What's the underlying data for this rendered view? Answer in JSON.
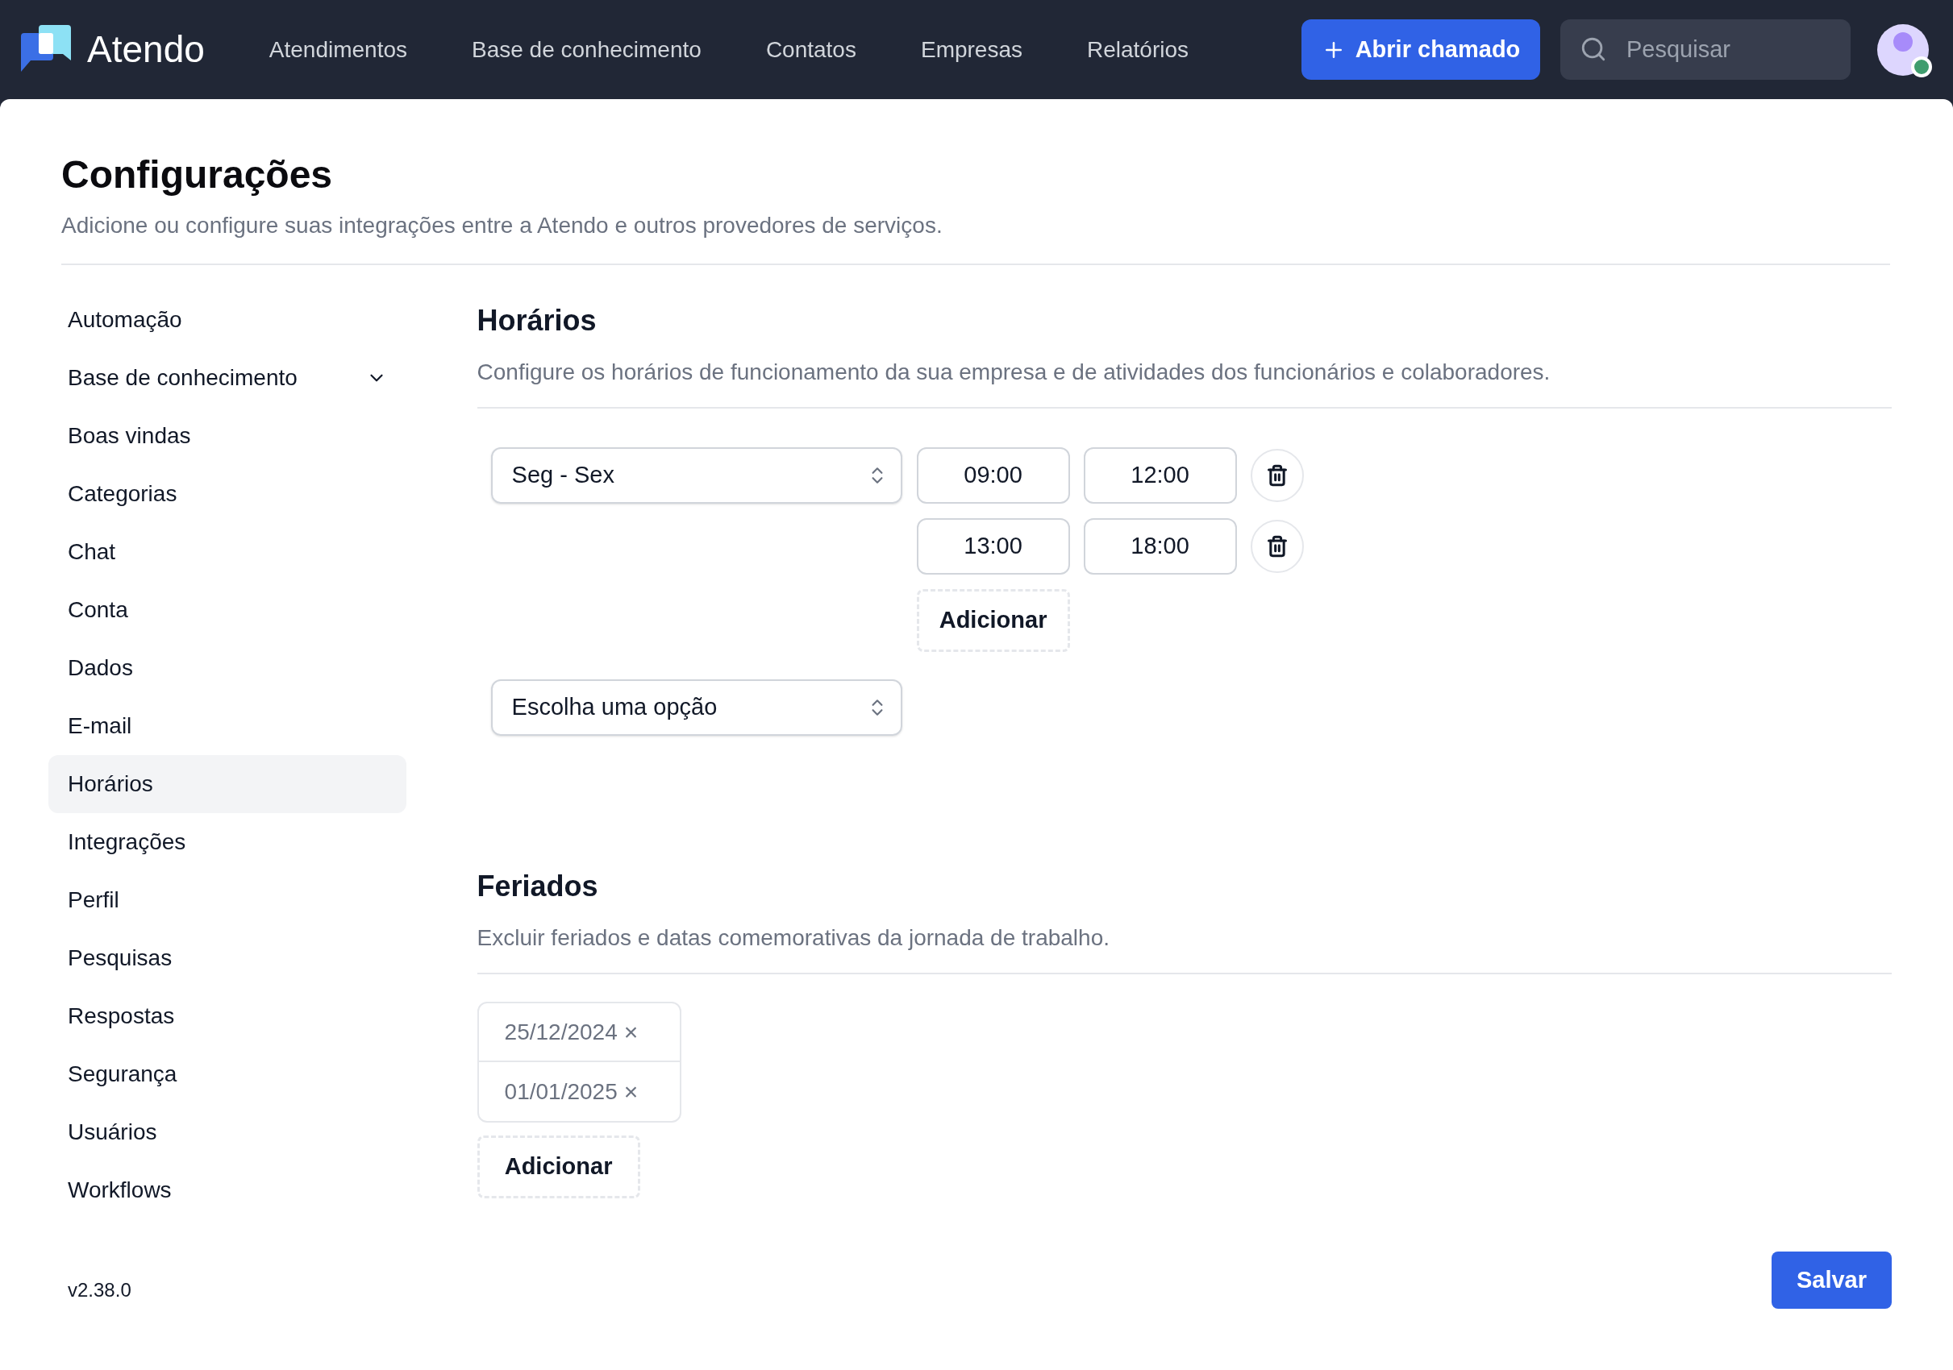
{
  "header": {
    "brand": "Atendo",
    "nav": [
      {
        "label": "Atendimentos",
        "selected": false
      },
      {
        "label": "Base de conhecimento",
        "selected": false
      },
      {
        "label": "Contatos",
        "selected": false
      },
      {
        "label": "Empresas",
        "selected": false
      },
      {
        "label": "Relatórios",
        "selected": false
      }
    ],
    "new_button": "Abrir chamado",
    "search": {
      "placeholder": "Pesquisar"
    },
    "avatar": {
      "online": true
    }
  },
  "page": {
    "title": "Configurações",
    "subtitle": "Adicione ou configure suas integrações entre a Atendo e outros provedores de serviços."
  },
  "sidebar": {
    "items": [
      {
        "label": "Automação",
        "selected": false,
        "expandable": false
      },
      {
        "label": "Base de conhecimento",
        "selected": false,
        "expandable": true
      },
      {
        "label": "Boas vindas",
        "selected": false,
        "expandable": false
      },
      {
        "label": "Categorias",
        "selected": false,
        "expandable": false
      },
      {
        "label": "Chat",
        "selected": false,
        "expandable": false
      },
      {
        "label": "Conta",
        "selected": false,
        "expandable": false
      },
      {
        "label": "Dados",
        "selected": false,
        "expandable": false
      },
      {
        "label": "E-mail",
        "selected": false,
        "expandable": false
      },
      {
        "label": "Horários",
        "selected": true,
        "expandable": false
      },
      {
        "label": "Integrações",
        "selected": false,
        "expandable": false
      },
      {
        "label": "Perfil",
        "selected": false,
        "expandable": false
      },
      {
        "label": "Pesquisas",
        "selected": false,
        "expandable": false
      },
      {
        "label": "Respostas",
        "selected": false,
        "expandable": false
      },
      {
        "label": "Segurança",
        "selected": false,
        "expandable": false
      },
      {
        "label": "Usuários",
        "selected": false,
        "expandable": false
      },
      {
        "label": "Workflows",
        "selected": false,
        "expandable": false
      }
    ],
    "version": "v2.38.0"
  },
  "schedule": {
    "title": "Horários",
    "description": "Configure os horários de funcionamento da sua empresa e de atividades dos funcionários e colaboradores.",
    "groups": [
      {
        "days": "Seg - Sex",
        "ranges": [
          {
            "start": "09:00",
            "end": "12:00"
          },
          {
            "start": "13:00",
            "end": "18:00"
          }
        ],
        "add_button": "Adicionar"
      },
      {
        "days": "Escolha uma opção"
      }
    ]
  },
  "holidays": {
    "title": "Feriados",
    "description": "Excluir feriados e datas comemorativas da jornada de trabalho.",
    "dates": [
      "25/12/2024",
      "01/01/2025"
    ],
    "remove_mark": "×",
    "add_button": "Adicionar"
  },
  "save_button": "Salvar"
}
